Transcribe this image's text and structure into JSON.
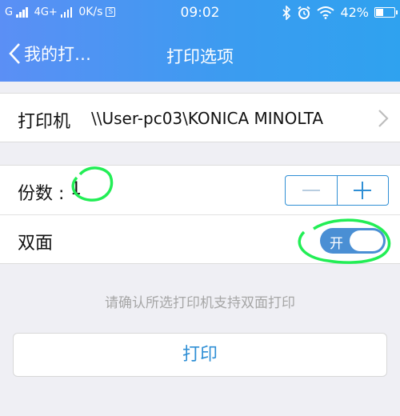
{
  "status_bar": {
    "carrier1": "G",
    "carrier2": "4G+",
    "speed": "0K/s",
    "sim_badge": "S",
    "time": "09:02",
    "battery": "42%"
  },
  "nav": {
    "back_label": "我的打…",
    "title": "打印选项"
  },
  "printer": {
    "label": "打印机",
    "name": "\\\\User-pc03\\KONICA MINOLTA"
  },
  "copies": {
    "label": "份数 :",
    "value": "1",
    "minus": "−",
    "plus": "+"
  },
  "duplex": {
    "label": "双面",
    "toggle_text": "开",
    "enabled": true
  },
  "hint": "请确认所选打印机支持双面打印",
  "print_button": "打印",
  "colors": {
    "header_start": "#5b8ff5",
    "header_end": "#2fa2ef",
    "accent": "#2f8fd5",
    "toggle_on": "#4a8fd4",
    "annotation": "#22ee55"
  }
}
